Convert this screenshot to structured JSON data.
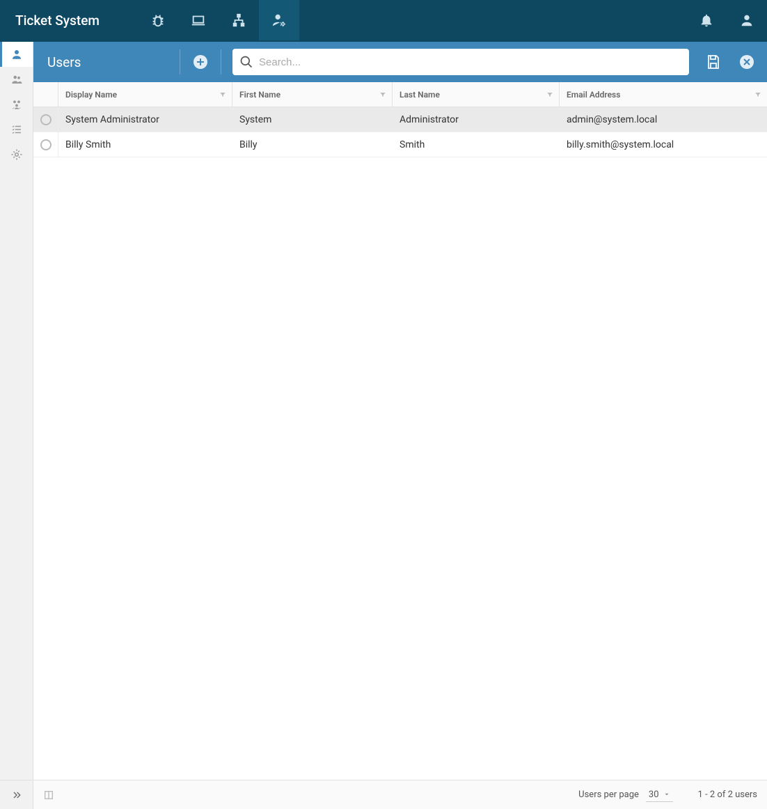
{
  "app": {
    "title": "Ticket System"
  },
  "topnav": {
    "tabs": [
      "bug",
      "laptop",
      "network",
      "user-admin"
    ],
    "active_index": 3
  },
  "sidebar": {
    "items": [
      "users",
      "groups",
      "teams",
      "checklist",
      "settings"
    ],
    "active_index": 0
  },
  "toolbar": {
    "title": "Users",
    "search_placeholder": "Search..."
  },
  "table": {
    "columns": {
      "display_name": "Display Name",
      "first_name": "First Name",
      "last_name": "Last Name",
      "email": "Email Address"
    },
    "rows": [
      {
        "display_name": "System Administrator",
        "first_name": "System",
        "last_name": "Administrator",
        "email": "admin@system.local",
        "selected": true
      },
      {
        "display_name": "Billy Smith",
        "first_name": "Billy",
        "last_name": "Smith",
        "email": "billy.smith@system.local",
        "selected": false
      }
    ]
  },
  "footer": {
    "per_page_label": "Users per page",
    "per_page_value": "30",
    "range_text": "1 - 2 of 2 users"
  }
}
